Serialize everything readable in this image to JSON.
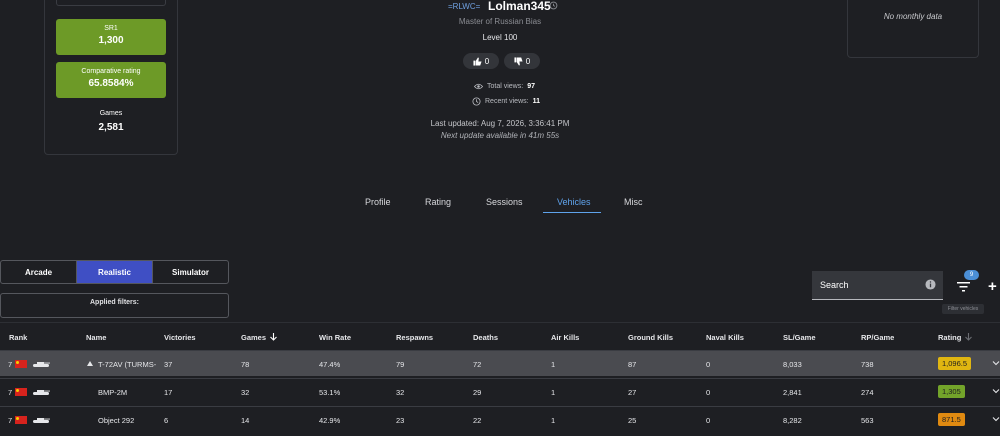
{
  "left_stats": {
    "sr1": {
      "label": "SR1",
      "value": "1,300"
    },
    "comparative": {
      "label": "Comparative rating",
      "value": "65.8584%"
    },
    "games": {
      "label": "Games",
      "value": "2,581"
    }
  },
  "right_card": {
    "text": "No monthly data"
  },
  "profile": {
    "clan": "=RLWC=",
    "username": "Lolman345",
    "title": "Master of Russian Bias",
    "level": "Level 100",
    "likes": "0",
    "dislikes": "0",
    "total_views_label": "Total views:",
    "total_views": "97",
    "recent_views_label": "Recent views:",
    "recent_views": "11",
    "last_updated": "Last updated: Aug 7, 2026, 3:36:41 PM",
    "next_update": "Next update available in 41m 55s"
  },
  "tabs": [
    {
      "label": "Profile"
    },
    {
      "label": "Rating"
    },
    {
      "label": "Sessions"
    },
    {
      "label": "Vehicles",
      "active": true
    },
    {
      "label": "Misc"
    }
  ],
  "modes": [
    {
      "label": "Arcade"
    },
    {
      "label": "Realistic",
      "active": true
    },
    {
      "label": "Simulator"
    }
  ],
  "applied_filters_label": "Applied filters:",
  "search": {
    "placeholder": "Search"
  },
  "filter_badge": "9",
  "filter_tooltip": "Filter vehicles",
  "table": {
    "headers": [
      "Rank",
      "Name",
      "Victories",
      "Games",
      "Win Rate",
      "Respawns",
      "Deaths",
      "Air Kills",
      "Ground Kills",
      "Naval Kills",
      "SL/Game",
      "RP/Game",
      "Rating"
    ],
    "rows": [
      {
        "rank": "7",
        "name": "T-72AV (TURMS-",
        "victories": "37",
        "games": "78",
        "win_rate": "47.4%",
        "respawns": "79",
        "deaths": "72",
        "air_kills": "1",
        "ground_kills": "87",
        "naval_kills": "0",
        "sl_game": "8,033",
        "rp_game": "738",
        "rating": "1,096.5",
        "rating_color": "#e0b611"
      },
      {
        "rank": "7",
        "name": "BMP-2M",
        "victories": "17",
        "games": "32",
        "win_rate": "53.1%",
        "respawns": "32",
        "deaths": "29",
        "air_kills": "1",
        "ground_kills": "27",
        "naval_kills": "0",
        "sl_game": "2,841",
        "rp_game": "274",
        "rating": "1,305",
        "rating_color": "#73a42a"
      },
      {
        "rank": "7",
        "name": "Object 292",
        "victories": "6",
        "games": "14",
        "win_rate": "42.9%",
        "respawns": "23",
        "deaths": "22",
        "air_kills": "1",
        "ground_kills": "25",
        "naval_kills": "0",
        "sl_game": "8,282",
        "rp_game": "563",
        "rating": "871.5",
        "rating_color": "#e08a11"
      }
    ]
  }
}
